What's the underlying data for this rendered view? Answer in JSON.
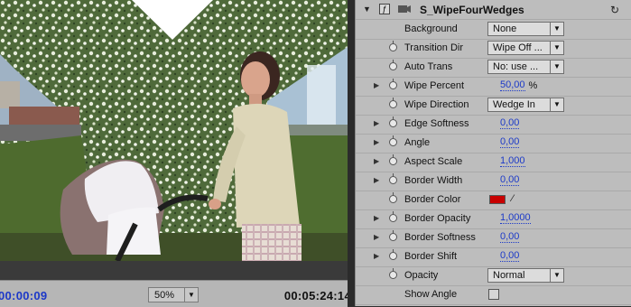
{
  "monitor": {
    "current_time": "00:00:09",
    "duration": "00:05:24:14",
    "zoom": "50%"
  },
  "effect": {
    "name": "S_WipeFourWedges",
    "rows": [
      {
        "label": "Background",
        "kind": "select",
        "value": "None",
        "expandable": false,
        "stopwatch": false
      },
      {
        "label": "Transition Dir",
        "kind": "select",
        "value": "Wipe Off ...",
        "expandable": false,
        "stopwatch": true
      },
      {
        "label": "Auto Trans",
        "kind": "select",
        "value": "No: use ...",
        "expandable": false,
        "stopwatch": true
      },
      {
        "label": "Wipe Percent",
        "kind": "number",
        "value": "50,00",
        "unit": "%",
        "expandable": true,
        "stopwatch": true
      },
      {
        "label": "Wipe Direction",
        "kind": "select",
        "value": "Wedge In",
        "expandable": false,
        "stopwatch": true
      },
      {
        "label": "Edge Softness",
        "kind": "number",
        "value": "0,00",
        "unit": "",
        "expandable": true,
        "stopwatch": true
      },
      {
        "label": "Angle",
        "kind": "number",
        "value": "0,00",
        "unit": "",
        "expandable": true,
        "stopwatch": true
      },
      {
        "label": "Aspect Scale",
        "kind": "number",
        "value": "1,000",
        "unit": "",
        "expandable": true,
        "stopwatch": true
      },
      {
        "label": "Border Width",
        "kind": "number",
        "value": "0,00",
        "unit": "",
        "expandable": true,
        "stopwatch": true
      },
      {
        "label": "Border Color",
        "kind": "color",
        "value": "#c80000",
        "expandable": false,
        "stopwatch": true
      },
      {
        "label": "Border Opacity",
        "kind": "number",
        "value": "1,0000",
        "unit": "",
        "expandable": true,
        "stopwatch": true
      },
      {
        "label": "Border Softness",
        "kind": "number",
        "value": "0,00",
        "unit": "",
        "expandable": true,
        "stopwatch": true
      },
      {
        "label": "Border Shift",
        "kind": "number",
        "value": "0,00",
        "unit": "",
        "expandable": true,
        "stopwatch": true
      },
      {
        "label": "Opacity",
        "kind": "select",
        "value": "Normal",
        "expandable": false,
        "stopwatch": true
      },
      {
        "label": "Show Angle",
        "kind": "checkbox",
        "value": "",
        "expandable": false,
        "stopwatch": false
      }
    ]
  },
  "icons": {
    "expand": "triangle-right-icon",
    "collapse": "triangle-down-icon",
    "stopwatch": "stopwatch-icon",
    "dropdown": "chevron-down-icon",
    "eyedropper": "eyedropper-icon",
    "reset": "reset-icon"
  }
}
